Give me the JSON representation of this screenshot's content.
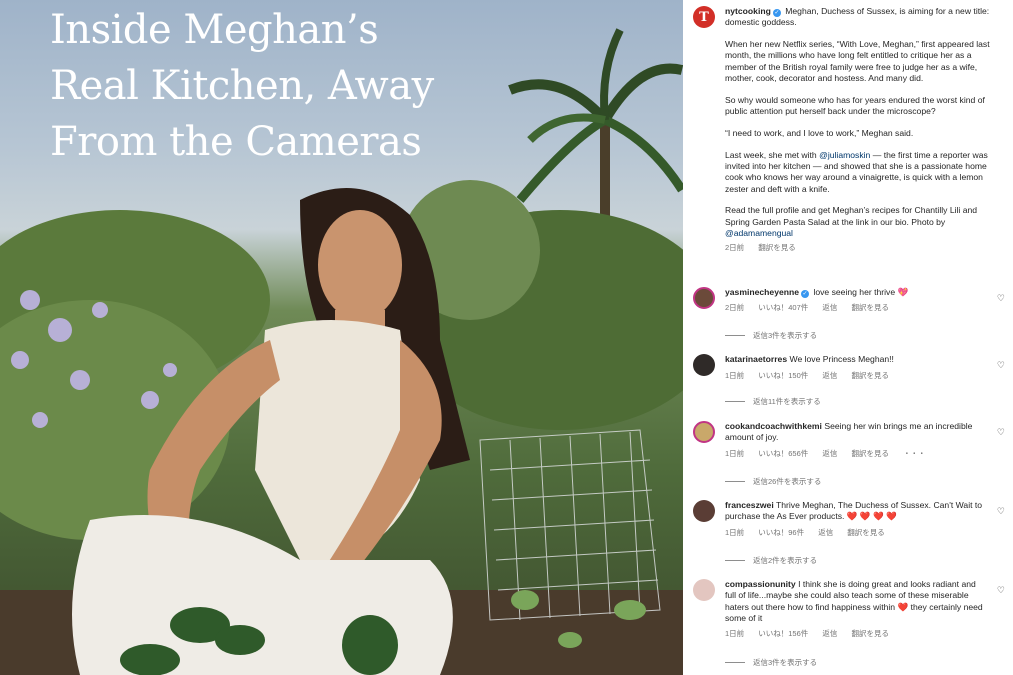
{
  "photo": {
    "headline": [
      "Inside Meghan’s",
      "Real Kitchen, Away",
      "From the Cameras"
    ]
  },
  "post": {
    "avatar_letter": "T",
    "username": "nytcooking",
    "caption": [
      "Meghan, Duchess of Sussex, is aiming for a new title: domestic goddess.",
      "When her new Netflix series, “With Love, Meghan,” first appeared last month, the millions who have long felt entitled to critique her as a member of the British royal family were free to judge her as a wife, mother, cook, decorator and hostess. And many did.",
      "So why would someone who has for years endured the worst kind of public attention put herself back under the microscope?",
      "“I need to work, and I love to work,” Meghan said.",
      "the first time a reporter was invited into her kitchen — and showed that she is a passionate home cook who knows her way around a vinaigrette, is quick with a lemon zester and deft with a knife.",
      "Read the full profile and get Meghan’s recipes for Chantilly Lili and Spring Garden Pasta Salad at the link in our bio. Photo by"
    ],
    "caption_para5_prefix": "Last week, she met with",
    "mention_1": "@juliamoskin",
    "mention_2": "@adamamengual",
    "time": "2日前",
    "see_translation": "翻訳を見る"
  },
  "colors": {
    "accent_blue": "#3897f0",
    "mention": "#00376b",
    "heart_red": "#e0245e",
    "nyt_red": "#d22f27"
  },
  "icons": {
    "verified": "verified-badge-icon",
    "like": "heart-outline-icon",
    "heart_emoji": "red-heart-emoji",
    "sparkle_heart": "sparkling-heart-emoji"
  },
  "comments": [
    {
      "user": "yasminecheyenne",
      "verified": true,
      "text": "love seeing her thrive",
      "emoji": "💖",
      "time": "2日前",
      "likes": "いいね！407件",
      "reply": "返信",
      "translate": "翻訳を見る",
      "view_replies": "返信3件を表示する",
      "avatar_color": "#6b4a3a"
    },
    {
      "user": "katarinaetorres",
      "verified": false,
      "text": "We love Princess Meghan!!",
      "emoji": "",
      "time": "1日前",
      "likes": "いいね！150件",
      "reply": "返信",
      "translate": "翻訳を見る",
      "view_replies": "返信11件を表示する",
      "avatar_color": "#2f2a28"
    },
    {
      "user": "cookandcoachwithkemi",
      "verified": false,
      "text": "Seeing her win brings me an incredible amount of joy.",
      "emoji": "",
      "time": "1日前",
      "likes": "いいね！656件",
      "reply": "返信",
      "translate": "翻訳を見る",
      "more": "・・・",
      "view_replies": "返信26件を表示する",
      "avatar_color": "#c9a86a"
    },
    {
      "user": "franceszwei",
      "verified": false,
      "text": "Thrive Meghan, The Duchess of Sussex. Can't Wait to purchase the As Ever products.",
      "emoji": "❤️ ❤️ ❤️ ❤️",
      "time": "1日前",
      "likes": "いいね！96件",
      "reply": "返信",
      "translate": "翻訳を見る",
      "view_replies": "返信2件を表示する",
      "avatar_color": "#5a3d35"
    },
    {
      "user": "compassionunity",
      "verified": false,
      "text": "I think she is doing great and looks radiant and full of life...maybe she could also teach some of these miserable haters out there how to find happiness within",
      "text_after": "they certainly need some of it",
      "emoji": "❤️",
      "time": "1日前",
      "likes": "いいね！156件",
      "reply": "返信",
      "translate": "翻訳を見る",
      "view_replies": "返信3件を表示する",
      "avatar_color": "#e3c6c0"
    }
  ]
}
